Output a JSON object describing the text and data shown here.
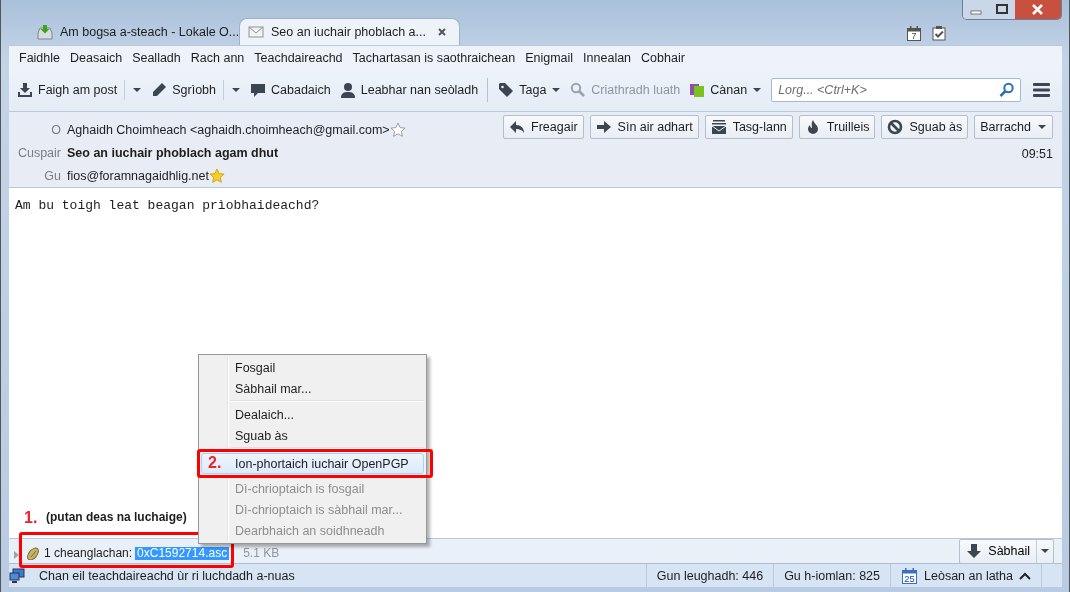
{
  "titlebar": {
    "tabs": [
      {
        "label": "Am bogsa a-steach - Lokale O...",
        "selected": false
      },
      {
        "label": "Seo an iuchair phoblach a...",
        "selected": true
      }
    ],
    "calendar_day": "7"
  },
  "menubar": [
    "Faidhle",
    "Deasaich",
    "Sealladh",
    "Rach ann",
    "Teachdaireachd",
    "Tachartasan is saothraichean",
    "Enigmail",
    "Innealan",
    "Cobhair"
  ],
  "toolbar": {
    "items": [
      {
        "label": "Faigh am post",
        "dropdown": true,
        "disabled": false,
        "separator_before": false
      },
      {
        "label": "Sgrìobh",
        "dropdown": true,
        "disabled": false,
        "separator_before": false
      },
      {
        "label": "Cabadaich",
        "dropdown": false,
        "disabled": false,
        "separator_before": false
      },
      {
        "label": "Leabhar nan seòladh",
        "dropdown": false,
        "disabled": false,
        "separator_before": false
      },
      {
        "label": "Taga",
        "dropdown": true,
        "disabled": false,
        "separator_before": true
      },
      {
        "label": "Criathradh luath",
        "dropdown": false,
        "disabled": true,
        "separator_before": false
      },
      {
        "label": "Cànan",
        "dropdown": true,
        "disabled": false,
        "separator_before": false
      }
    ],
    "search": {
      "placeholder": "Lorg... <Ctrl+K>"
    }
  },
  "header": {
    "fields": [
      {
        "label": "O",
        "value": "Aghaidh Choimheach <aghaidh.choimheach@gmail.com>",
        "kind": "contact",
        "starred": false
      },
      {
        "label": "Cuspair",
        "value": "Seo an iuchair phoblach agam dhut",
        "kind": "subject"
      },
      {
        "label": "Gu",
        "value": "fios@foramnagaidhlig.net",
        "kind": "contact",
        "starred": true
      }
    ],
    "actions": [
      {
        "label": "Freagair",
        "dropdown": false
      },
      {
        "label": "Sìn air adhart",
        "dropdown": false
      },
      {
        "label": "Tasg-lann",
        "dropdown": false
      },
      {
        "label": "Truilleis",
        "dropdown": false
      },
      {
        "label": "Sguab às",
        "dropdown": false
      },
      {
        "label": "Barrachd",
        "dropdown": true
      }
    ],
    "time": "09:51"
  },
  "body": {
    "text": "Am bu toigh leat beagan prìobhaideachd?"
  },
  "context_menu": {
    "items": [
      {
        "kind": "item",
        "label": "Fosgail",
        "disabled": false,
        "selected": false
      },
      {
        "kind": "item",
        "label": "Sàbhail mar...",
        "disabled": false,
        "selected": false
      },
      {
        "kind": "separator"
      },
      {
        "kind": "item",
        "label": "Dealaich...",
        "disabled": false,
        "selected": false
      },
      {
        "kind": "item",
        "label": "Sguab às",
        "disabled": false,
        "selected": false
      },
      {
        "kind": "separator"
      },
      {
        "kind": "item",
        "label": "Ion-phortaich iuchair OpenPGP",
        "disabled": false,
        "selected": true
      },
      {
        "kind": "item",
        "label": "Dì-chrioptaich is fosgail",
        "disabled": true,
        "selected": false
      },
      {
        "kind": "item",
        "label": "Dì-chrioptaich is sàbhail mar...",
        "disabled": true,
        "selected": false
      },
      {
        "kind": "item",
        "label": "Dearbhaich an soidhneadh",
        "disabled": true,
        "selected": false
      }
    ]
  },
  "annotations": [
    {
      "number": "1.",
      "text": "(putan deas na luchaige)"
    },
    {
      "number": "2."
    }
  ],
  "attachments": {
    "count": "1 cheanglachan:",
    "filename": "0xC1592714.asc",
    "selected": true,
    "size": "5.1 KB",
    "save": "Sàbhail"
  },
  "status_bar": {
    "message": "Chan eil teachdaireachd ùr ri luchdadh a-nuas",
    "unread": "Gun leughadh: 446",
    "total": "Gu h-iomlan: 825",
    "today_day": "25",
    "today_pane": "Leòsan an latha"
  }
}
